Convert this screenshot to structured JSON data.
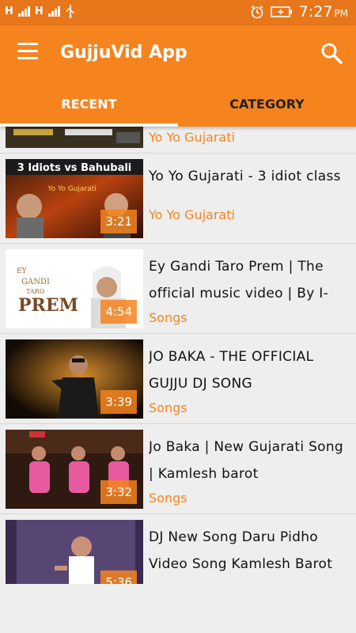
{
  "status_bar": {
    "left_icons": [
      "H",
      "signal",
      "H",
      "signal",
      "usb"
    ],
    "right_icons": [
      "alarm",
      "battery-charging"
    ],
    "time": "7:27",
    "ampm": "PM"
  },
  "app_bar": {
    "title": "GujjuVid App",
    "menu_icon": "hamburger-icon",
    "search_icon": "search-icon"
  },
  "tabs": [
    {
      "label": "RECENT",
      "selected": true
    },
    {
      "label": "CATEGORY",
      "selected": false
    }
  ],
  "colors": {
    "primary": "#f5841f",
    "primary_dark": "#e8761b",
    "background": "#eeeeee",
    "category_text": "#f5841f"
  },
  "videos": [
    {
      "title": "",
      "category": "Yo Yo Gujarati",
      "duration": ""
    },
    {
      "title": "Yo Yo Gujarati - 3 idiot class",
      "category": "Yo Yo Gujarati",
      "duration": "3:21",
      "thumb_text": "3 Idiots vs Bahubali"
    },
    {
      "title": "Ey Gandi Taro Prem | The official music video | By I-",
      "category": "Songs",
      "duration": "4:54",
      "thumb_text": "EY GANDI TARO PREM"
    },
    {
      "title": "JO BAKA - THE OFFICIAL GUJJU DJ SONG",
      "category": "Songs",
      "duration": "3:39"
    },
    {
      "title": "Jo Baka | New Gujarati Song | Kamlesh barot",
      "category": "Songs",
      "duration": "3:32"
    },
    {
      "title": "DJ New Song Daru Pidho Video Song Kamlesh Barot",
      "category": "",
      "duration": "5:36"
    }
  ]
}
